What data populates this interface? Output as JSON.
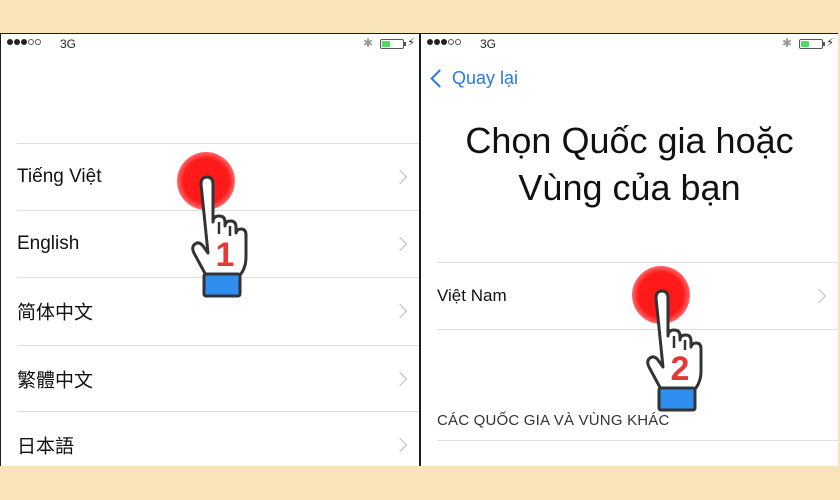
{
  "colors": {
    "background": "#f8e4b8",
    "link_blue": "#2a7ae2",
    "battery_green": "#4cd964",
    "tap_red": "#ff1a1a",
    "cuff_blue": "#2f8ef0",
    "step_number_red": "#e53935"
  },
  "status_bar": {
    "signal_dots": [
      true,
      true,
      true,
      false,
      false
    ],
    "network": "3G",
    "bluetooth_icon": "bluetooth-icon",
    "battery_level": 0.4,
    "charging_icon": "bolt-icon"
  },
  "screen1": {
    "languages": [
      {
        "label": "Tiếng Việt"
      },
      {
        "label": "English"
      },
      {
        "label": "简体中文"
      },
      {
        "label": "繁體中文"
      },
      {
        "label": "日本語"
      }
    ],
    "tap_marker": {
      "step": "1",
      "target": "Tiếng Việt"
    }
  },
  "screen2": {
    "back_label": "Quay lại",
    "title_line1": "Chọn Quốc gia hoặc",
    "title_line2": "Vùng của bạn",
    "suggested": {
      "label": "Việt Nam"
    },
    "section_header": "CÁC QUỐC GIA VÀ VÙNG KHÁC",
    "tap_marker": {
      "step": "2",
      "target": "Việt Nam"
    }
  }
}
